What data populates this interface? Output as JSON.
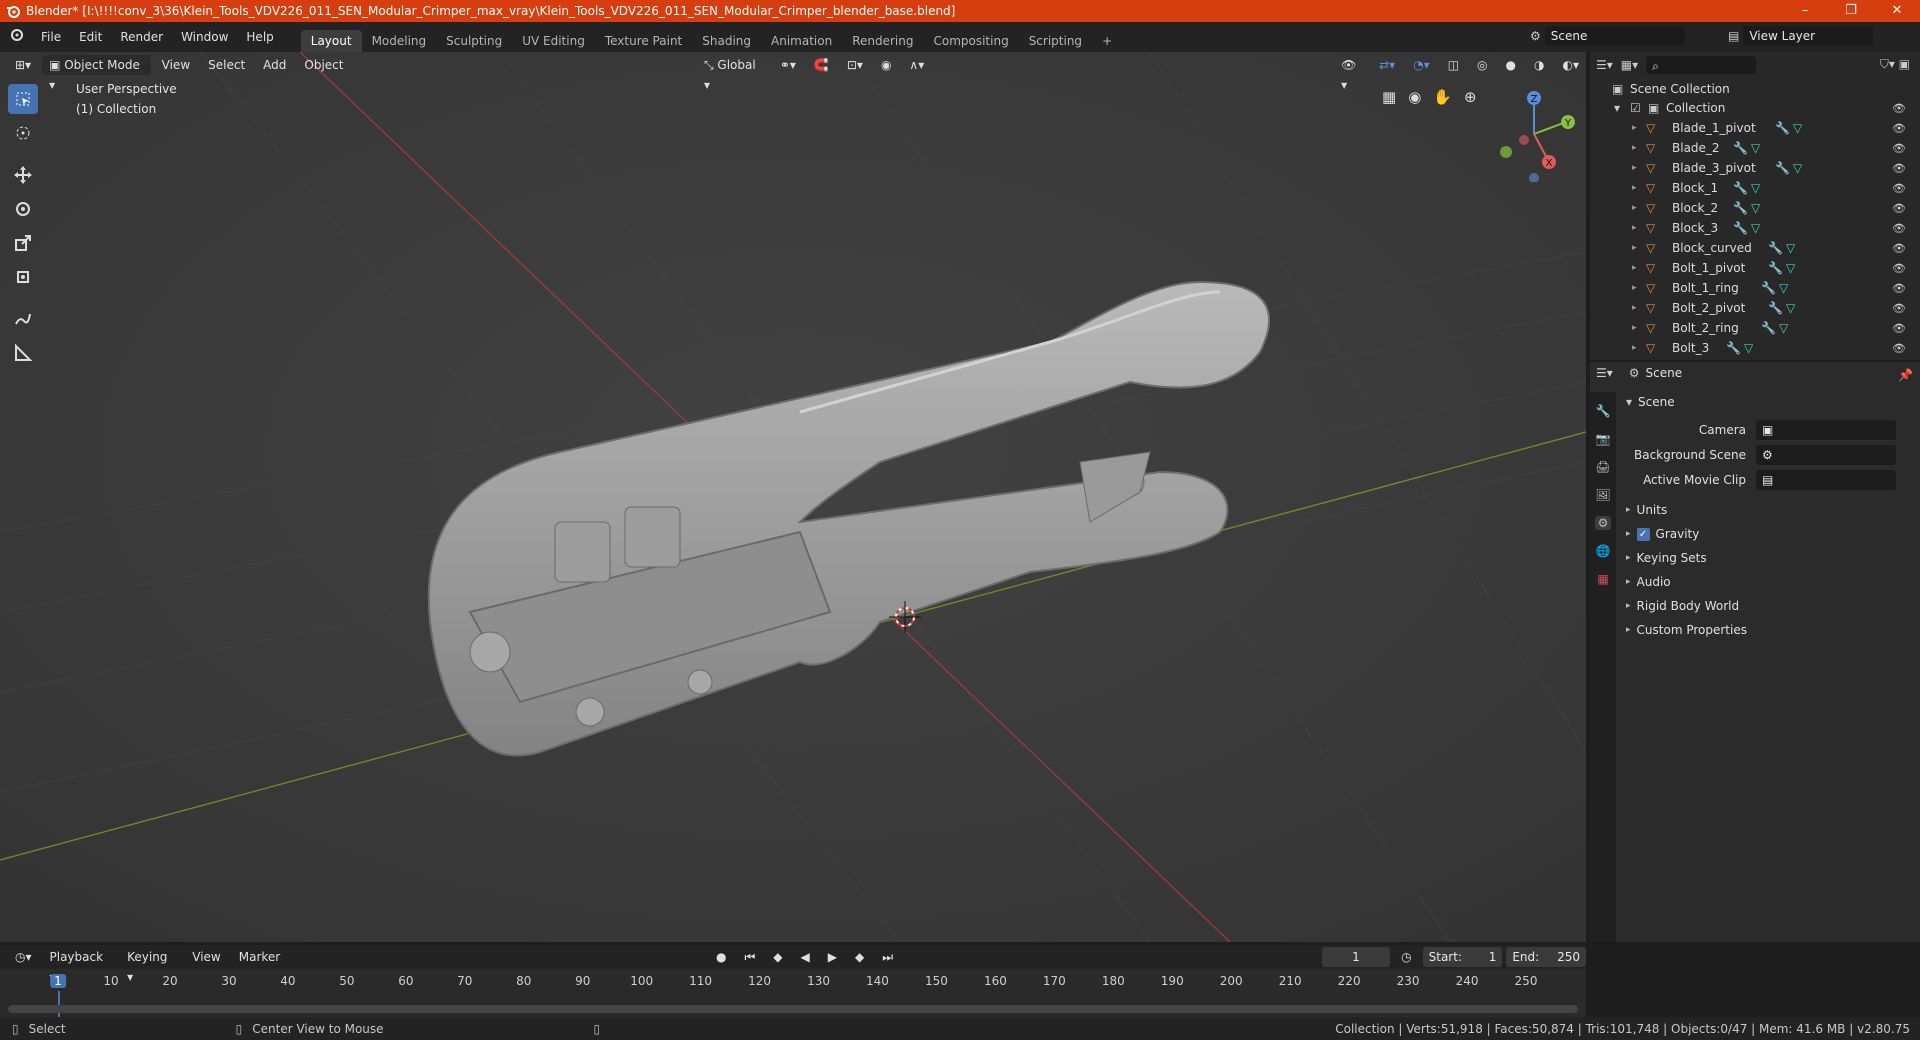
{
  "titlebar": {
    "title": "Blender* [I:\\!!!!conv_3\\36\\Klein_Tools_VDV226_011_SEN_Modular_Crimper_max_vray\\Klein_Tools_VDV226_011_SEN_Modular_Crimper_blender_base.blend]",
    "minimize": "–",
    "maximize": "❐",
    "close": "✕"
  },
  "menu": [
    "File",
    "Edit",
    "Render",
    "Window",
    "Help"
  ],
  "workspaces": [
    "Layout",
    "Modeling",
    "Sculpting",
    "UV Editing",
    "Texture Paint",
    "Shading",
    "Animation",
    "Rendering",
    "Compositing",
    "Scripting"
  ],
  "active_workspace": "Layout",
  "add_workspace": "+",
  "scene_selector": "Scene",
  "view_layer": "View Layer",
  "viewport": {
    "mode": "Object Mode",
    "menus": [
      "View",
      "Select",
      "Add",
      "Object"
    ],
    "transform_orientation": "Global",
    "overlay_title": "User Perspective",
    "overlay_collection": "(1) Collection",
    "gizmo_axes": {
      "z": "Z",
      "y": "Y",
      "x": "X"
    }
  },
  "outliner": {
    "root": "Scene Collection",
    "collection": "Collection",
    "items": [
      "Blade_1_pivot",
      "Blade_2",
      "Blade_3_pivot",
      "Block_1",
      "Block_2",
      "Block_3",
      "Block_curved",
      "Bolt_1_pivot",
      "Bolt_1_ring",
      "Bolt_2_pivot",
      "Bolt_2_ring",
      "Bolt_3"
    ]
  },
  "properties": {
    "header": "Scene",
    "panel_title": "Scene",
    "camera_label": "Camera",
    "background_scene_label": "Background Scene",
    "active_movie_clip_label": "Active Movie Clip",
    "sections": [
      "Units",
      "Gravity",
      "Keying Sets",
      "Audio",
      "Rigid Body World",
      "Custom Properties"
    ],
    "gravity_checked": true
  },
  "timeline": {
    "menus": [
      "Playback",
      "Keying",
      "View",
      "Marker"
    ],
    "current_frame": "1",
    "start_label": "Start:",
    "start_value": "1",
    "end_label": "End:",
    "end_value": "250",
    "ticks": [
      "1",
      "10",
      "20",
      "30",
      "40",
      "50",
      "60",
      "70",
      "80",
      "90",
      "100",
      "110",
      "120",
      "130",
      "140",
      "150",
      "160",
      "170",
      "180",
      "190",
      "200",
      "210",
      "220",
      "230",
      "240",
      "250"
    ]
  },
  "statusbar": {
    "left_hint": "Select",
    "middle_hint": "Center View to Mouse",
    "stats": "Collection | Verts:51,918 | Faces:50,874 | Tris:101,748 | Objects:0/47 | Mem: 41.6 MB | v2.80.75"
  },
  "colors": {
    "titlebar": "#d63e10",
    "accent": "#4772b3",
    "mesh_icon": "#e8893a",
    "modifier_icon": "#5f9bd8",
    "data_icon": "#3fd3b5"
  }
}
